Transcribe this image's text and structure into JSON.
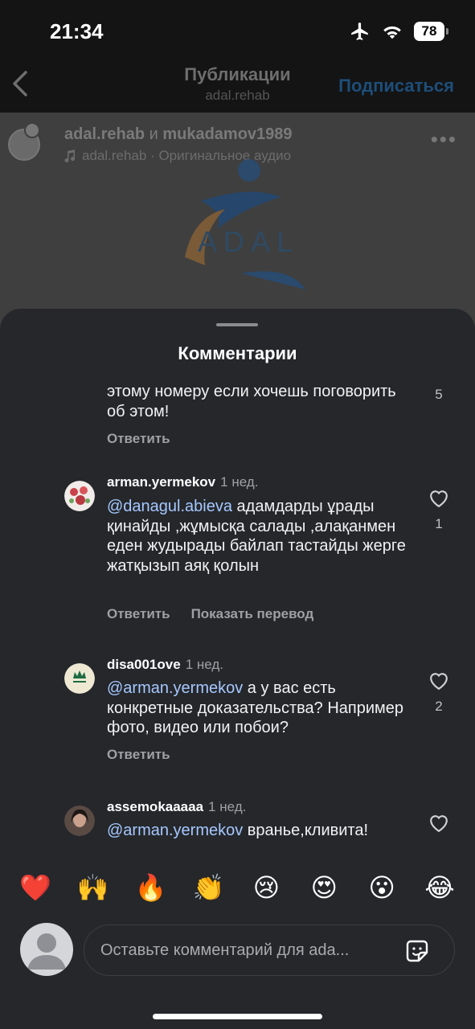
{
  "status": {
    "time": "21:34",
    "battery": "78"
  },
  "nav": {
    "title": "Публикации",
    "subtitle": "adal.rehab",
    "subscribe": "Подписаться"
  },
  "post": {
    "user1": "adal.rehab",
    "joiner": "и",
    "user2": "mukadamov1989",
    "audio": "adal.rehab · Оригинальное аудио",
    "logo_text": "ADAL"
  },
  "sheet": {
    "title": "Комментарии"
  },
  "comments": [
    {
      "body": "этому номеру если хочешь поговорить об этом!",
      "reply": "Ответить",
      "likes": "5"
    },
    {
      "username": "arman.yermekov",
      "time": "1 нед.",
      "mention": "@danagul.abieva",
      "body": " адамдарды ұрады қинайды ,жұмысқа салады ,алақанмен еден жудырады байлап тастайды жерге жатқызып аяқ қолын",
      "reply": "Ответить",
      "translate": "Показать перевод",
      "likes": "1",
      "avatar_color": "#c9434a"
    },
    {
      "username": "disa001ove",
      "time": "1 нед.",
      "mention": "@arman.yermekov",
      "body": " а у вас есть конкретные доказательства? Например фото, видео или побои?",
      "reply": "Ответить",
      "likes": "2",
      "avatar_color": "#efe9d4"
    },
    {
      "username": "assemokaaaaa",
      "time": "1 нед.",
      "mention": "@arman.yermekov",
      "body": " вранье,кливита!",
      "avatar_color": "#4a3a36"
    }
  ],
  "reactions": [
    "❤️",
    "🙌",
    "🔥",
    "👏",
    "😢",
    "😍",
    "😮",
    "😂"
  ],
  "input": {
    "placeholder": "Оставьте комментарий для ada..."
  }
}
